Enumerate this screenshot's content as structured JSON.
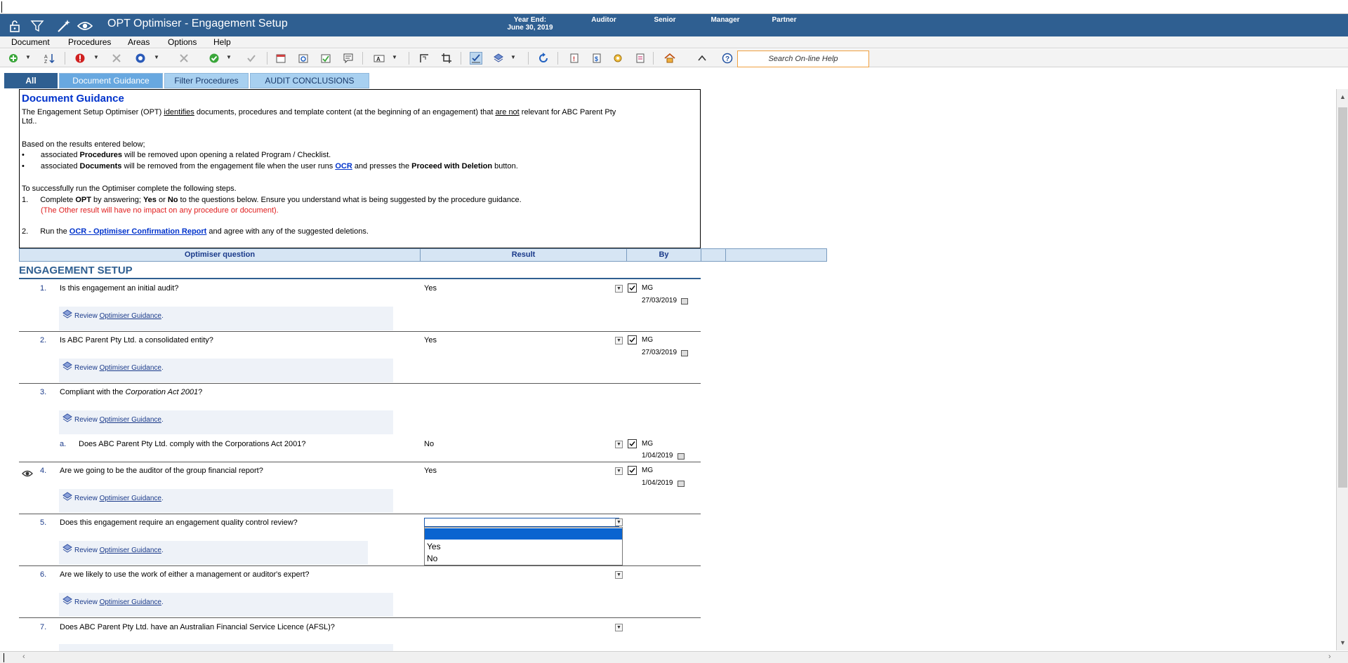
{
  "window": {
    "title": "OPT Optimiser - Engagement Setup",
    "header_cols": [
      {
        "label": "Year End:",
        "value": "June 30, 2019"
      },
      {
        "label": "Auditor",
        "value": ""
      },
      {
        "label": "Senior",
        "value": ""
      },
      {
        "label": "Manager",
        "value": ""
      },
      {
        "label": "Partner",
        "value": ""
      }
    ]
  },
  "menu": [
    "Document",
    "Procedures",
    "Areas",
    "Options",
    "Help"
  ],
  "search": {
    "placeholder": "Search On-line Help"
  },
  "tabs": [
    "All",
    "Document Guidance",
    "Filter Procedures",
    "AUDIT CONCLUSIONS"
  ],
  "guidance": {
    "heading": "Document Guidance",
    "p1_a": "The Engagement Setup Optimiser (OPT) ",
    "p1_b": "identifies",
    "p1_c": " documents, procedures and  template content (at the beginning of an engagement) that ",
    "p1_d": "are not",
    "p1_e": " relevant for ABC Parent Pty",
    "p1_f": "Ltd..",
    "p2": "Based on the results entered below;",
    "b1_a": "associated ",
    "b1_b": "Procedures",
    "b1_c": " will be removed upon opening a related Program / Checklist.",
    "b2_a": "associated ",
    "b2_b": "Documents",
    "b2_c": " will be removed from the engagement file when the user runs ",
    "b2_d": "OCR",
    "b2_e": " and presses the  ",
    "b2_f": "Proceed with Deletion",
    "b2_g": " button.",
    "p3": "To successfully run the Optimiser complete the following steps.",
    "s1_num": "1.",
    "s1_a": "Complete ",
    "s1_b": "OPT",
    "s1_c": " by answering; ",
    "s1_d": "Yes",
    "s1_e": " or ",
    "s1_f": "No",
    "s1_g": " to the questions below. Ensure you understand what is being suggested by the procedure guidance.",
    "s1_red": "(The Other result will have no impact on any procedure or document).",
    "s2_num": "2.",
    "s2_a": "Run the ",
    "s2_b": "OCR - Optimiser Confirmation Report",
    "s2_c": " and agree with any of the suggested deletions.",
    "bullet": "•"
  },
  "columns": [
    "Optimiser question",
    "Result",
    "By"
  ],
  "section_title": "ENGAGEMENT SETUP",
  "guidance_link": {
    "prefix": "Review ",
    "link": "Optimiser Guidance",
    "suffix": "."
  },
  "questions": [
    {
      "num": "1.",
      "text": "Is this engagement an initial audit?",
      "result": "Yes",
      "by": "MG",
      "date": "27/03/2019"
    },
    {
      "num": "2.",
      "text": "Is ABC Parent Pty Ltd. a consolidated entity?",
      "result": "Yes",
      "by": "MG",
      "date": "27/03/2019"
    },
    {
      "num": "3.",
      "text_a": "Compliant with the ",
      "text_b": "Corporation Act 2001",
      "text_c": "?"
    },
    {
      "num": "a.",
      "text": "Does ABC Parent Pty Ltd. comply with the Corporations Act 2001?",
      "result": "No",
      "by": "MG",
      "date": "1/04/2019"
    },
    {
      "num": "4.",
      "text": "Are we going to be the auditor of the group financial report?",
      "result": "Yes",
      "by": "MG",
      "date": "1/04/2019"
    },
    {
      "num": "5.",
      "text": "Does this engagement require an engagement quality control review?"
    },
    {
      "num": "6.",
      "text": "Are we likely to use the work of either a management or auditor's expert?"
    },
    {
      "num": "7.",
      "text": "Does ABC Parent Pty Ltd. have an Australian Financial Service Licence (AFSL)?"
    }
  ],
  "dropdown_options": [
    "",
    "Yes",
    "No"
  ]
}
